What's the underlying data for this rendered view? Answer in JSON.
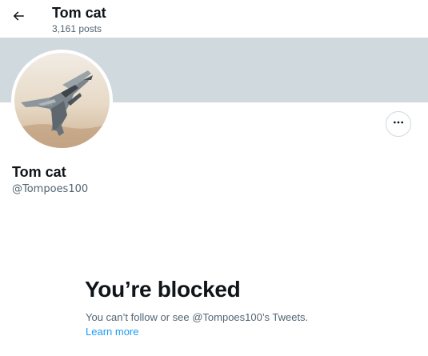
{
  "header": {
    "back_icon": "arrow-left-icon",
    "name": "Tom cat",
    "posts_count": "3,161 posts"
  },
  "banner": {
    "color": "#cfd9de"
  },
  "profile": {
    "avatar_icon": "fighter-jet-avatar",
    "name": "Tom cat",
    "handle": "@Tompoes100",
    "more_icon": "more-options-icon"
  },
  "blocked": {
    "title": "You’re blocked",
    "description": "You can’t follow or see @Tompoes100’s Tweets.",
    "learn_more": "Learn more"
  },
  "colors": {
    "text_primary": "#0f1419",
    "text_secondary": "#536471",
    "link": "#1d9bf0",
    "border": "#cfd9de"
  }
}
